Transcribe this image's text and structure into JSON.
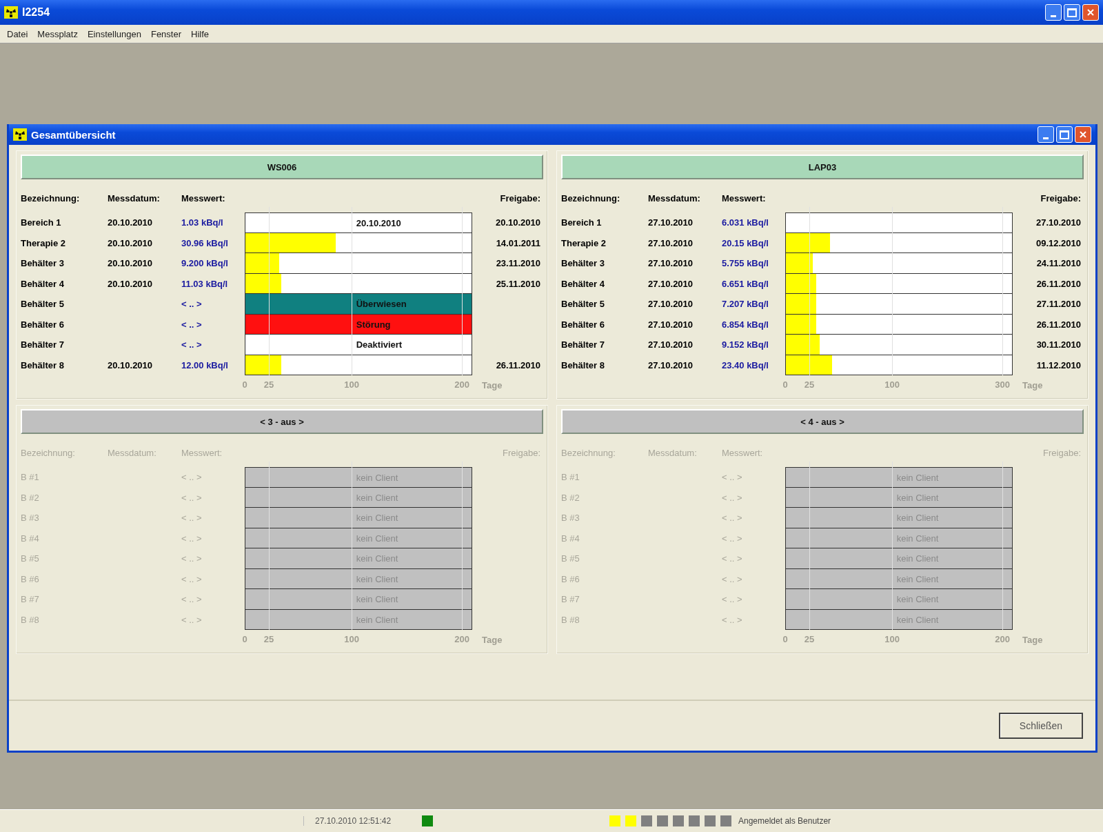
{
  "app_window": {
    "title": "I2254"
  },
  "menu": [
    "Datei",
    "Messplatz",
    "Einstellungen",
    "Fenster",
    "Hilfe"
  ],
  "window": {
    "title": "Gesamtübersicht"
  },
  "panels": [
    {
      "header": "WS006",
      "disabled": false,
      "columns": [
        "Bezeichnung:",
        "Messdatum:",
        "Messwert:",
        "Freigabe:"
      ],
      "ticks": [
        "0",
        "25",
        "100",
        "200"
      ],
      "unit": "Tage",
      "rows": [
        {
          "name": "Bereich 1",
          "date": "20.10.2010",
          "value": "1.03 kBq/l",
          "kind": "label",
          "text": "20.10.2010",
          "release": "20.10.2010"
        },
        {
          "name": "Therapie 2",
          "date": "20.10.2010",
          "value": "30.96 kBq/l",
          "kind": "bar",
          "level": 0.4,
          "release": "14.01.2011"
        },
        {
          "name": "Behälter 3",
          "date": "20.10.2010",
          "value": "9.200 kBq/l",
          "kind": "bar",
          "level": 0.15,
          "release": "23.11.2010"
        },
        {
          "name": "Behälter 4",
          "date": "20.10.2010",
          "value": "11.03 kBq/l",
          "kind": "bar",
          "level": 0.16,
          "release": "25.11.2010"
        },
        {
          "name": "Behälter 5",
          "value": "< .. >",
          "kind": "status",
          "text": "Überwiesen",
          "color": "#108080"
        },
        {
          "name": "Behälter 6",
          "value": "< .. >",
          "kind": "status",
          "text": "Störung",
          "color": "#ff1010"
        },
        {
          "name": "Behälter 7",
          "value": "< .. >",
          "kind": "status",
          "text": "Deaktiviert",
          "color": "#ffffff"
        },
        {
          "name": "Behälter 8",
          "date": "20.10.2010",
          "value": "12.00 kBq/l",
          "kind": "bar",
          "level": 0.16,
          "release": "26.11.2010"
        }
      ]
    },
    {
      "header": "LAP03",
      "disabled": false,
      "columns": [
        "Bezeichnung:",
        "Messdatum:",
        "Messwert:",
        "Freigabe:"
      ],
      "ticks": [
        "0",
        "25",
        "100",
        "300"
      ],
      "unit": "Tage",
      "rows": [
        {
          "name": "Bereich 1",
          "date": "27.10.2010",
          "value": "6.031 kBq/l",
          "kind": "bar",
          "release": "27.10.2010"
        },
        {
          "name": "Therapie 2",
          "date": "27.10.2010",
          "value": "20.15 kBq/l",
          "kind": "bar",
          "level": 0.195,
          "release": "09.12.2010"
        },
        {
          "name": "Behälter 3",
          "date": "27.10.2010",
          "value": "5.755 kBq/l",
          "kind": "bar",
          "level": 0.12,
          "release": "24.11.2010"
        },
        {
          "name": "Behälter 4",
          "date": "27.10.2010",
          "value": "6.651 kBq/l",
          "kind": "bar",
          "level": 0.135,
          "release": "26.11.2010"
        },
        {
          "name": "Behälter 5",
          "date": "27.10.2010",
          "value": "7.207 kBq/l",
          "kind": "bar",
          "level": 0.135,
          "release": "27.11.2010"
        },
        {
          "name": "Behälter 6",
          "date": "27.10.2010",
          "value": "6.854 kBq/l",
          "kind": "bar",
          "level": 0.135,
          "release": "26.11.2010"
        },
        {
          "name": "Behälter 7",
          "date": "27.10.2010",
          "value": "9.152 kBq/l",
          "kind": "bar",
          "level": 0.15,
          "release": "30.11.2010"
        },
        {
          "name": "Behälter 8",
          "date": "27.10.2010",
          "value": "23.40 kBq/l",
          "kind": "bar",
          "level": 0.205,
          "release": "11.12.2010"
        }
      ]
    },
    {
      "header": "< 3 - aus >",
      "disabled": true,
      "columns": [
        "Bezeichnung:",
        "Messdatum:",
        "Messwert:",
        "Freigabe:"
      ],
      "ticks": [
        "0",
        "25",
        "100",
        "200"
      ],
      "unit": "Tage",
      "rows": [
        {
          "name": "B #1",
          "value": "< .. >",
          "kind": "status",
          "text": "kein Client",
          "color": "#c0c0c0"
        },
        {
          "name": "B #2",
          "value": "< .. >",
          "kind": "status",
          "text": "kein Client",
          "color": "#c0c0c0"
        },
        {
          "name": "B #3",
          "value": "< .. >",
          "kind": "status",
          "text": "kein Client",
          "color": "#c0c0c0"
        },
        {
          "name": "B #4",
          "value": "< .. >",
          "kind": "status",
          "text": "kein Client",
          "color": "#c0c0c0"
        },
        {
          "name": "B #5",
          "value": "< .. >",
          "kind": "status",
          "text": "kein Client",
          "color": "#c0c0c0"
        },
        {
          "name": "B #6",
          "value": "< .. >",
          "kind": "status",
          "text": "kein Client",
          "color": "#c0c0c0"
        },
        {
          "name": "B #7",
          "value": "< .. >",
          "kind": "status",
          "text": "kein Client",
          "color": "#c0c0c0"
        },
        {
          "name": "B #8",
          "value": "< .. >",
          "kind": "status",
          "text": "kein Client",
          "color": "#c0c0c0"
        }
      ]
    },
    {
      "header": "< 4 - aus >",
      "disabled": true,
      "columns": [
        "Bezeichnung:",
        "Messdatum:",
        "Messwert:",
        "Freigabe:"
      ],
      "ticks": [
        "0",
        "25",
        "100",
        "200"
      ],
      "unit": "Tage",
      "rows": [
        {
          "name": "B #1",
          "value": "< .. >",
          "kind": "status",
          "text": "kein Client",
          "color": "#c0c0c0"
        },
        {
          "name": "B #2",
          "value": "< .. >",
          "kind": "status",
          "text": "kein Client",
          "color": "#c0c0c0"
        },
        {
          "name": "B #3",
          "value": "< .. >",
          "kind": "status",
          "text": "kein Client",
          "color": "#c0c0c0"
        },
        {
          "name": "B #4",
          "value": "< .. >",
          "kind": "status",
          "text": "kein Client",
          "color": "#c0c0c0"
        },
        {
          "name": "B #5",
          "value": "< .. >",
          "kind": "status",
          "text": "kein Client",
          "color": "#c0c0c0"
        },
        {
          "name": "B #6",
          "value": "< .. >",
          "kind": "status",
          "text": "kein Client",
          "color": "#c0c0c0"
        },
        {
          "name": "B #7",
          "value": "< .. >",
          "kind": "status",
          "text": "kein Client",
          "color": "#c0c0c0"
        },
        {
          "name": "B #8",
          "value": "< .. >",
          "kind": "status",
          "text": "kein Client",
          "color": "#c0c0c0"
        }
      ]
    }
  ],
  "close_button": "Schließen",
  "status_bar": {
    "datetime": "27.10.2010 12:51:42",
    "indicators": [
      {
        "kind": "connection",
        "color": "#108a10"
      },
      {
        "color": "#ffff00"
      },
      {
        "color": "#ffff00"
      },
      {
        "color": "#808080"
      },
      {
        "color": "#808080"
      },
      {
        "color": "#808080"
      },
      {
        "color": "#808080"
      },
      {
        "color": "#808080"
      },
      {
        "color": "#808080"
      }
    ],
    "user": "Angemeldet als Benutzer"
  }
}
